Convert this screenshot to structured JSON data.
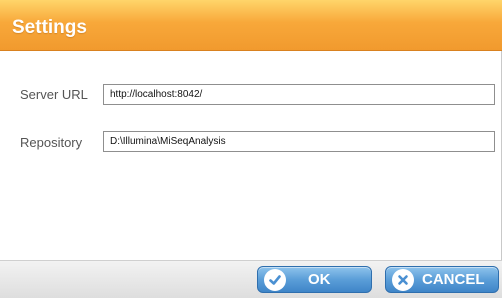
{
  "dialog": {
    "title": "Settings",
    "fields": {
      "server_url": {
        "label": "Server URL",
        "value": "http://localhost:8042/"
      },
      "repository": {
        "label": "Repository",
        "value": "D:\\Illumina\\MiSeqAnalysis"
      }
    },
    "buttons": {
      "ok": {
        "label": "OK",
        "icon": "check-icon"
      },
      "cancel": {
        "label": "CANCEL",
        "icon": "close-icon"
      }
    },
    "colors": {
      "title_bar": "#f5a437",
      "button": "#4a90d2"
    }
  }
}
